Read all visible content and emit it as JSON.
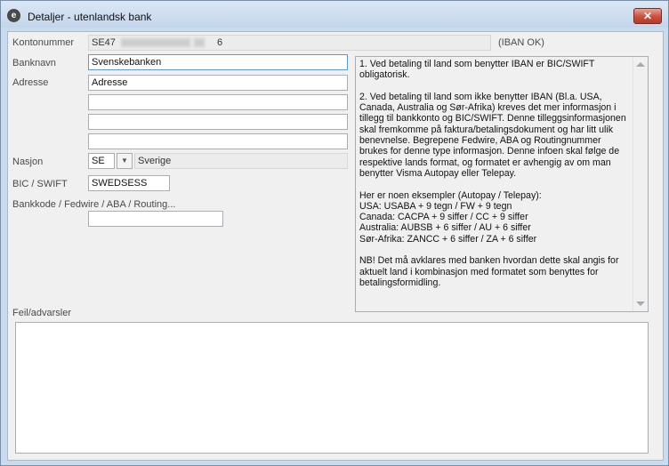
{
  "window": {
    "title": "Detaljer - utenlandsk bank",
    "app_icon": "e",
    "close_label": "✕"
  },
  "form": {
    "kontonummer": {
      "label": "Kontonummer",
      "prefix": "SE47",
      "suffix": "6",
      "status": "(IBAN OK)"
    },
    "banknavn": {
      "label": "Banknavn",
      "value": "Svenskebanken"
    },
    "adresse": {
      "label": "Adresse",
      "lines": [
        "Adresse",
        "",
        "",
        ""
      ]
    },
    "nasjon": {
      "label": "Nasjon",
      "code": "SE",
      "name": "Sverige"
    },
    "bic": {
      "label": "BIC / SWIFT",
      "value": "SWEDSESS"
    },
    "bankkode": {
      "label": "Bankkode / Fedwire / ABA / Routing...",
      "value": ""
    }
  },
  "info": {
    "paragraphs": [
      "1. Ved betaling til land som benytter IBAN er BIC/SWIFT obligatorisk.",
      "2. Ved betaling til land som ikke benytter IBAN (Bl.a. USA, Canada, Australia og Sør-Afrika) kreves det mer informasjon i tillegg til bankkonto og BIC/SWIFT. Denne tilleggsinformasjonen skal fremkomme på faktura/betalingsdokument og har litt ulik benevnelse. Begrepene Fedwire, ABA og Routingnummer brukes for denne type informasjon. Denne infoen skal følge de respektive lands format, og formatet er avhengig av om man benytter Visma Autopay eller Telepay.",
      "Her er noen eksempler (Autopay / Telepay):\nUSA: USABA + 9 tegn / FW + 9 tegn\nCanada: CACPA + 9 siffer / CC + 9 siffer\nAustralia: AUBSB + 6 siffer / AU + 6 siffer\nSør-Afrika: ZANCC + 6 siffer / ZA + 6 siffer",
      "NB! Det må avklares med banken hvordan dette skal angis for aktuelt land i kombinasjon med formatet som benyttes for betalingsformidling."
    ]
  },
  "feil": {
    "label": "Feil/advarsler",
    "value": ""
  }
}
